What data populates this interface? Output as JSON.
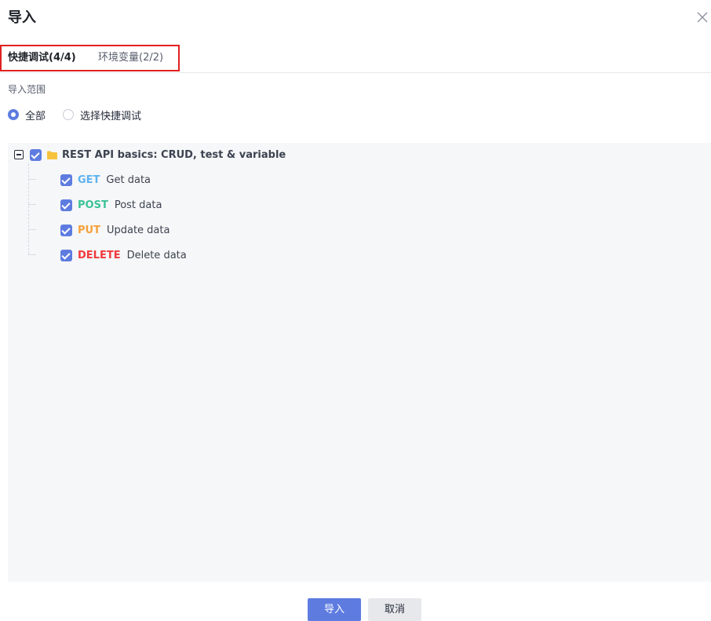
{
  "dialog": {
    "title": "导入",
    "close_icon": "close-icon"
  },
  "tabs": [
    {
      "label": "快捷调试(4/4)",
      "active": true
    },
    {
      "label": "环境变量(2/2)",
      "active": false
    }
  ],
  "scope": {
    "label": "导入范围",
    "options": [
      {
        "label": "全部",
        "checked": true
      },
      {
        "label": "选择快捷调试",
        "checked": false
      }
    ]
  },
  "tree": {
    "root": {
      "name": "REST API basics: CRUD, test & variable",
      "checked": true,
      "expanded": true,
      "icon": "folder-icon"
    },
    "items": [
      {
        "method": "GET",
        "name": "Get data",
        "checked": true
      },
      {
        "method": "POST",
        "name": "Post data",
        "checked": true
      },
      {
        "method": "PUT",
        "name": "Update data",
        "checked": true
      },
      {
        "method": "DELETE",
        "name": "Delete data",
        "checked": true
      }
    ]
  },
  "footer": {
    "import_label": "导入",
    "cancel_label": "取消"
  },
  "colors": {
    "accent": "#5e7ce0",
    "get": "#5eb2f0",
    "post": "#3ac295",
    "put": "#f7a03a",
    "delete": "#f0393c",
    "highlight_box": "#e02020"
  }
}
